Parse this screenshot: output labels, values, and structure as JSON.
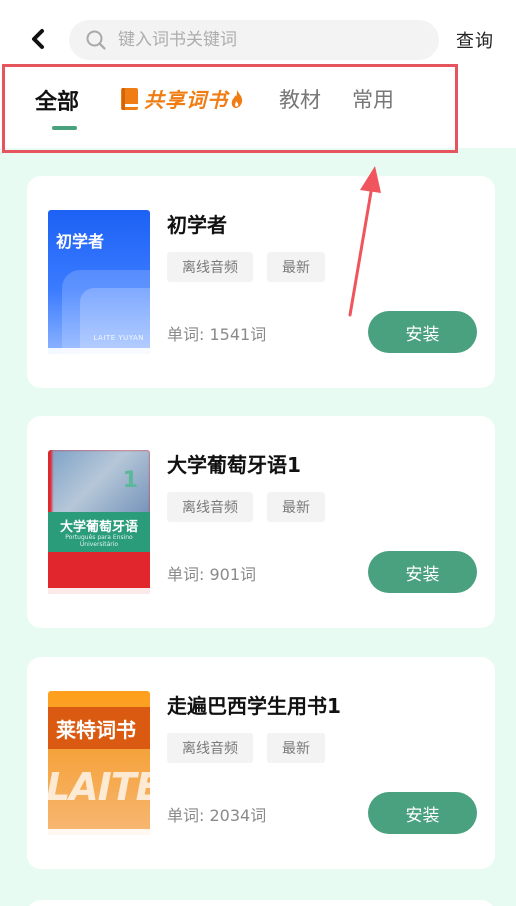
{
  "header": {
    "back_icon": "chevron-left-icon",
    "search_icon": "search-icon",
    "search_placeholder": "键入词书关键词",
    "query_label": "查询"
  },
  "tabs": [
    {
      "label": "全部",
      "active": true
    },
    {
      "label": "共享词书",
      "icon": "book-icon",
      "badge_icon": "flame-icon"
    },
    {
      "label": "教材"
    },
    {
      "label": "常用"
    }
  ],
  "books": [
    {
      "title": "初学者",
      "tags": [
        "离线音频",
        "最新"
      ],
      "word_count": "单词: 1541词",
      "install_label": "安装",
      "cover": {
        "text": "初学者",
        "subtext": "LAITE YUYAN"
      }
    },
    {
      "title": "大学葡萄牙语1",
      "tags": [
        "离线音频",
        "最新"
      ],
      "word_count": "单词: 901词",
      "install_label": "安装",
      "cover": {
        "number": "1",
        "text": "大学葡萄牙语",
        "subtext": "Português para Ensino Universitário"
      }
    },
    {
      "title": "走遍巴西学生用书1",
      "tags": [
        "离线音频",
        "最新"
      ],
      "word_count": "单词: 2034词",
      "install_label": "安装",
      "cover": {
        "text": "莱特词书",
        "subtext": "LAITE"
      }
    }
  ],
  "colors": {
    "accent": "#4aa17f",
    "content_bg": "#e8fbf3",
    "highlight": "#e6555d",
    "shared_tab": "#f07d13"
  }
}
